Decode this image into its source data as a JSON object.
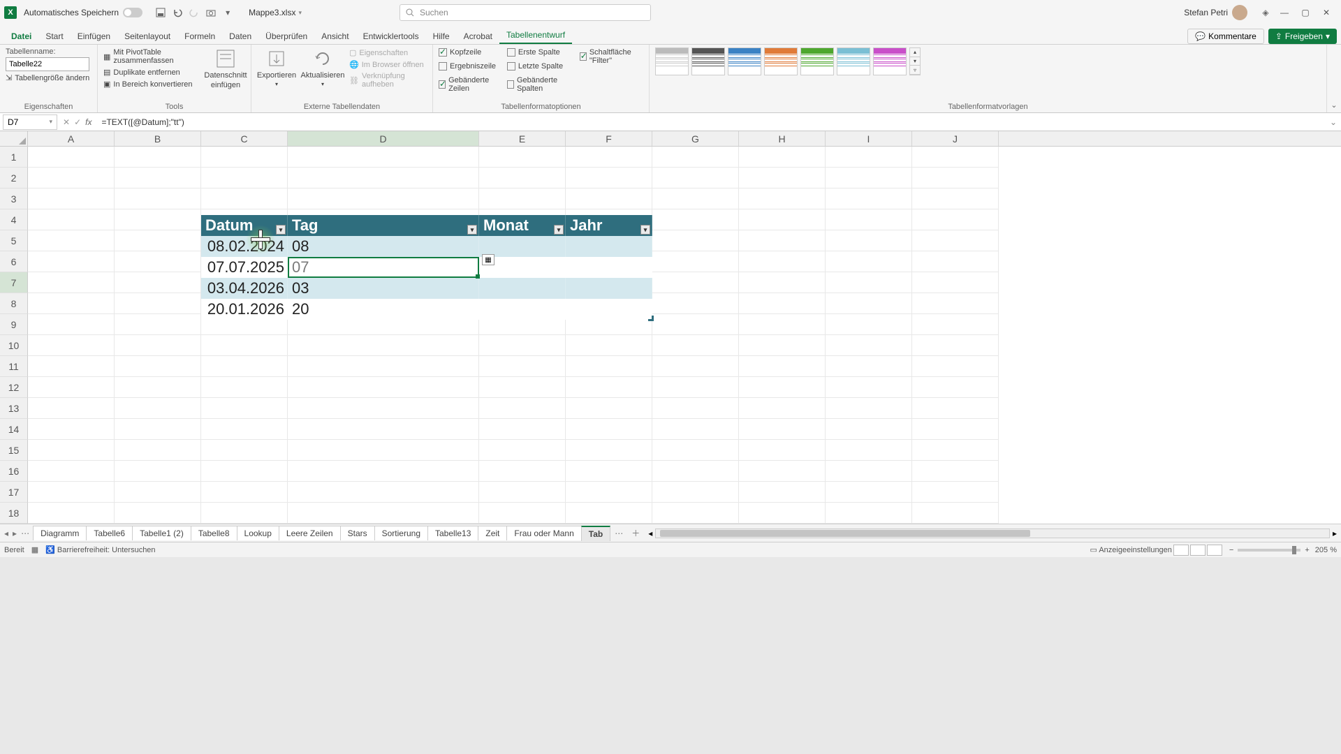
{
  "title": {
    "autosave": "Automatisches Speichern",
    "filename": "Mappe3.xlsx",
    "search_placeholder": "Suchen",
    "user": "Stefan Petri"
  },
  "ribbon_tabs": {
    "file": "Datei",
    "items": [
      "Start",
      "Einfügen",
      "Seitenlayout",
      "Formeln",
      "Daten",
      "Überprüfen",
      "Ansicht",
      "Entwicklertools",
      "Hilfe",
      "Acrobat",
      "Tabellenentwurf"
    ],
    "active": "Tabellenentwurf",
    "comments": "Kommentare",
    "share": "Freigeben"
  },
  "ribbon": {
    "props": {
      "name_label": "Tabellenname:",
      "name_value": "Tabelle22",
      "resize": "Tabellengröße ändern",
      "group": "Eigenschaften"
    },
    "tools": {
      "pivot": "Mit PivotTable zusammenfassen",
      "dupes": "Duplikate entfernen",
      "range": "In Bereich konvertieren",
      "slicer1": "Datenschnitt",
      "slicer2": "einfügen",
      "group": "Tools"
    },
    "ext": {
      "export": "Exportieren",
      "refresh": "Aktualisieren",
      "props": "Eigenschaften",
      "browser": "Im Browser öffnen",
      "unlink": "Verknüpfung aufheben",
      "group": "Externe Tabellendaten"
    },
    "styleopts": {
      "header": "Kopfzeile",
      "total": "Ergebniszeile",
      "banded_rows": "Gebänderte Zeilen",
      "first_col": "Erste Spalte",
      "last_col": "Letzte Spalte",
      "banded_cols": "Gebänderte Spalten",
      "filter": "Schaltfläche \"Filter\"",
      "group": "Tabellenformatoptionen"
    },
    "styles_group": "Tabellenformatvorlagen"
  },
  "formula": {
    "namebox": "D7",
    "value": "=TEXT([@Datum];\"tt\")"
  },
  "columns": [
    "A",
    "B",
    "C",
    "D",
    "E",
    "F",
    "G",
    "H",
    "I",
    "J"
  ],
  "table": {
    "headers": [
      "Datum",
      "Tag",
      "Monat",
      "Jahr"
    ],
    "rows": [
      {
        "datum": "08.02.2024",
        "tag": "08"
      },
      {
        "datum": "07.07.2025",
        "tag": "07"
      },
      {
        "datum": "03.04.2026",
        "tag": "03"
      },
      {
        "datum": "20.01.2026",
        "tag": "20"
      }
    ]
  },
  "sheets": [
    "Diagramm",
    "Tabelle6",
    "Tabelle1 (2)",
    "Tabelle8",
    "Lookup",
    "Leere Zeilen",
    "Stars",
    "Sortierung",
    "Tabelle13",
    "Zeit",
    "Frau oder Mann",
    "Tab"
  ],
  "status": {
    "ready": "Bereit",
    "access": "Barrierefreiheit: Untersuchen",
    "display": "Anzeigeeinstellungen",
    "zoom": "205 %"
  }
}
